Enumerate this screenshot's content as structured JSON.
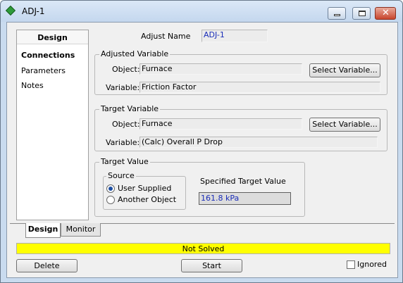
{
  "window": {
    "title": "ADJ-1",
    "min_icon": "minimize-icon",
    "max_icon": "maximize-icon",
    "close_icon": "close-icon",
    "close_glyph": "✕"
  },
  "sidebar": {
    "header": "Design",
    "items": [
      {
        "label": "Connections",
        "selected": true
      },
      {
        "label": "Parameters",
        "selected": false
      },
      {
        "label": "Notes",
        "selected": false
      }
    ]
  },
  "adjust": {
    "name_label": "Adjust Name",
    "name_value": "ADJ-1"
  },
  "adjusted_variable": {
    "title": "Adjusted Variable",
    "object_label": "Object:",
    "object_value": "Furnace",
    "variable_label": "Variable:",
    "variable_value": "Friction Factor",
    "select_button": "Select Variable..."
  },
  "target_variable": {
    "title": "Target Variable",
    "object_label": "Object:",
    "object_value": "Furnace",
    "variable_label": "Variable:",
    "variable_value": "(Calc) Overall P Drop",
    "select_button": "Select Variable..."
  },
  "target_value": {
    "title": "Target Value",
    "source_title": "Source",
    "source_options": [
      {
        "label": "User Supplied",
        "selected": true
      },
      {
        "label": "Another Object",
        "selected": false
      }
    ],
    "specified_label": "Specified Target Value",
    "specified_value": "161.8 kPa"
  },
  "tabs": [
    {
      "label": "Design",
      "active": true
    },
    {
      "label": "Monitor",
      "active": false
    }
  ],
  "status": {
    "text": "Not Solved",
    "color": "#ffff00"
  },
  "footer": {
    "delete_button": "Delete",
    "start_button": "Start",
    "ignored_label": "Ignored",
    "ignored_checked": false
  }
}
